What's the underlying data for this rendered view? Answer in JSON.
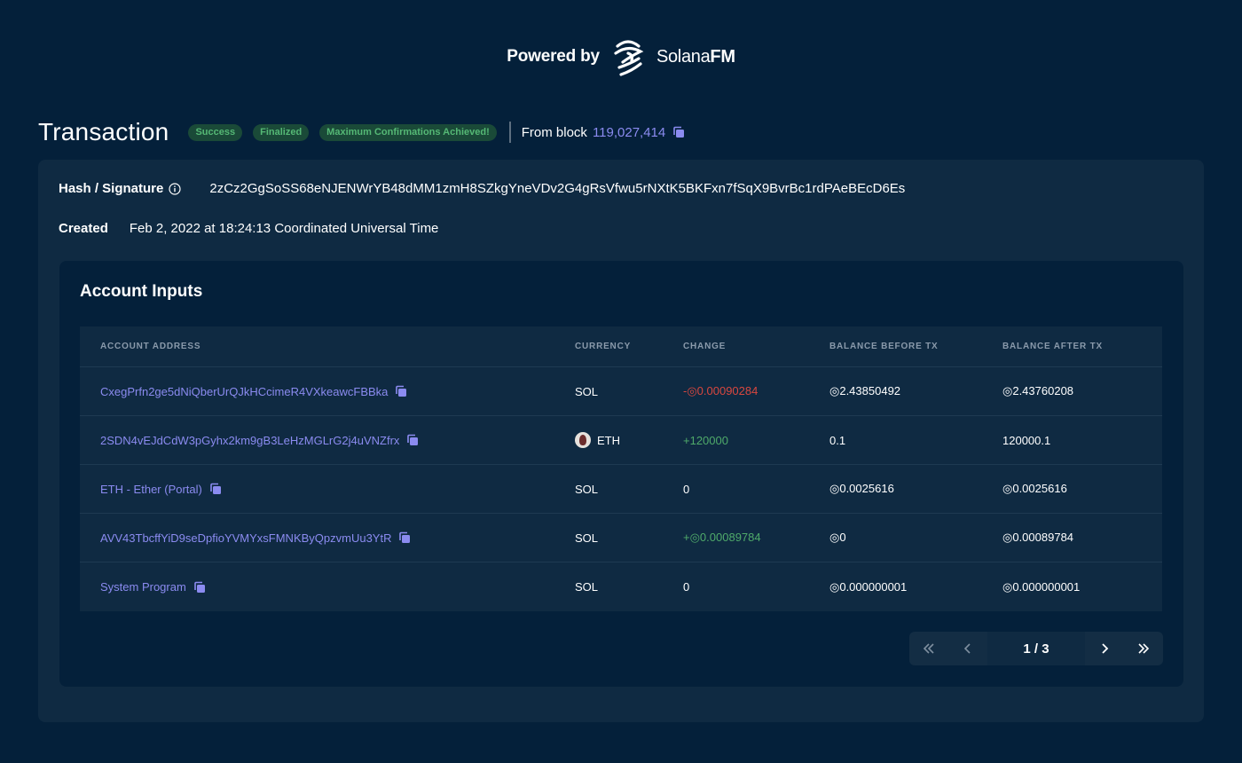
{
  "header": {
    "powered_by": "Powered by",
    "brand_light": "Solana",
    "brand_bold": "FM"
  },
  "transaction": {
    "title": "Transaction",
    "badges": [
      "Success",
      "Finalized",
      "Maximum Confirmations Achieved!"
    ],
    "from_block_label": "From block",
    "block_number": "119,027,414"
  },
  "details": {
    "hash_label": "Hash / Signature",
    "hash_value": "2zCz2GgSoSS68eNJENWrYB48dMM1zmH8SZkgYneVDv2G4gRsVfwu5rNXtK5BKFxn7fSqX9BvrBc1rdPAeBEcD6Es",
    "created_label": "Created",
    "created_value": "Feb 2, 2022 at 18:24:13 Coordinated Universal Time"
  },
  "account_inputs": {
    "title": "Account Inputs",
    "columns": [
      "ACCOUNT ADDRESS",
      "CURRENCY",
      "CHANGE",
      "BALANCE BEFORE TX",
      "BALANCE AFTER TX"
    ],
    "rows": [
      {
        "address": "CxegPrfn2ge5dNiQberUrQJkHCcimeR4VXkeawcFBBka",
        "currency": "SOL",
        "change": "-◎0.00090284",
        "change_sign": "neg",
        "before": "◎2.43850492",
        "after": "◎2.43760208",
        "avatar": false
      },
      {
        "address": "2SDN4vEJdCdW3pGyhx2km9gB3LeHzMGLrG2j4uVNZfrx",
        "currency": "ETH",
        "change": "+120000",
        "change_sign": "pos",
        "before": "0.1",
        "after": "120000.1",
        "avatar": true
      },
      {
        "address": "ETH - Ether (Portal)",
        "currency": "SOL",
        "change": "0",
        "change_sign": "zero",
        "before": "◎0.0025616",
        "after": "◎0.0025616",
        "avatar": false
      },
      {
        "address": "AVV43TbcffYiD9seDpfioYVMYxsFMNKByQpzvmUu3YtR",
        "currency": "SOL",
        "change": "+◎0.00089784",
        "change_sign": "pos",
        "before": "◎0",
        "after": "◎0.00089784",
        "avatar": false
      },
      {
        "address": "System Program",
        "currency": "SOL",
        "change": "0",
        "change_sign": "zero",
        "before": "◎0.000000001",
        "after": "◎0.000000001",
        "avatar": false
      }
    ]
  },
  "pagination": {
    "page_indicator": "1 / 3"
  },
  "colors": {
    "background": "#04203a",
    "card": "#0f2a42",
    "link": "#8b8bf0",
    "positive": "#4faa6a",
    "negative": "#d8473f",
    "badge_text": "#55b875"
  }
}
